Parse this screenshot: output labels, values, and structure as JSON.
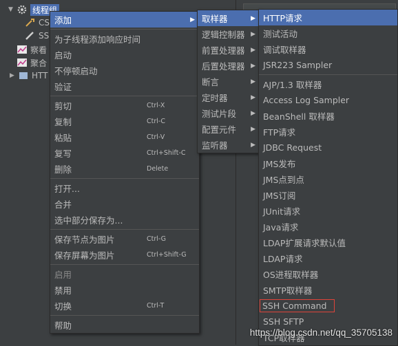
{
  "tree": {
    "thread_group": "线程组",
    "nodes": [
      "CS",
      "SS",
      "察看",
      "聚合",
      "HTT"
    ]
  },
  "menu_main": [
    {
      "label": "添加",
      "sub": true,
      "highlighted": true
    },
    {
      "sep": true
    },
    {
      "label": "为子线程添加响应时间"
    },
    {
      "label": "启动"
    },
    {
      "label": "不停顿启动"
    },
    {
      "label": "验证"
    },
    {
      "sep": true
    },
    {
      "label": "剪切",
      "acc": "Ctrl-X"
    },
    {
      "label": "复制",
      "acc": "Ctrl-C"
    },
    {
      "label": "粘贴",
      "acc": "Ctrl-V"
    },
    {
      "label": "复写",
      "acc": "Ctrl+Shift-C"
    },
    {
      "label": "删除",
      "acc": "Delete"
    },
    {
      "sep": true
    },
    {
      "label": "打开..."
    },
    {
      "label": "合并"
    },
    {
      "label": "选中部分保存为..."
    },
    {
      "sep": true
    },
    {
      "label": "保存节点为图片",
      "acc": "Ctrl-G"
    },
    {
      "label": "保存屏幕为图片",
      "acc": "Ctrl+Shift-G"
    },
    {
      "sep": true
    },
    {
      "label": "启用",
      "disabled": true
    },
    {
      "label": "禁用"
    },
    {
      "label": "切换",
      "acc": "Ctrl-T"
    },
    {
      "sep": true
    },
    {
      "label": "帮助"
    }
  ],
  "menu_add": [
    {
      "label": "取样器",
      "sub": true,
      "highlighted": true
    },
    {
      "label": "逻辑控制器",
      "sub": true
    },
    {
      "label": "前置处理器",
      "sub": true
    },
    {
      "label": "后置处理器",
      "sub": true
    },
    {
      "label": "断言",
      "sub": true
    },
    {
      "label": "定时器",
      "sub": true
    },
    {
      "label": "测试片段",
      "sub": true
    },
    {
      "label": "配置元件",
      "sub": true
    },
    {
      "label": "监听器",
      "sub": true
    }
  ],
  "menu_sampler": [
    {
      "label": "HTTP请求",
      "highlighted": true
    },
    {
      "label": "测试活动"
    },
    {
      "label": "调试取样器"
    },
    {
      "label": "JSR223 Sampler"
    },
    {
      "sep": true
    },
    {
      "label": "AJP/1.3 取样器"
    },
    {
      "label": "Access Log Sampler"
    },
    {
      "label": "BeanShell 取样器"
    },
    {
      "label": "FTP请求"
    },
    {
      "label": "JDBC Request"
    },
    {
      "label": "JMS发布"
    },
    {
      "label": "JMS点到点"
    },
    {
      "label": "JMS订阅"
    },
    {
      "label": "JUnit请求"
    },
    {
      "label": "Java请求"
    },
    {
      "label": "LDAP扩展请求默认值"
    },
    {
      "label": "LDAP请求"
    },
    {
      "label": "OS进程取样器"
    },
    {
      "label": "SMTP取样器"
    },
    {
      "label": "SSH Command",
      "boxed": true
    },
    {
      "label": "SSH SFTP"
    },
    {
      "label": "TCP取样器"
    }
  ],
  "watermark": "https://blog.csdn.net/qq_35705138"
}
